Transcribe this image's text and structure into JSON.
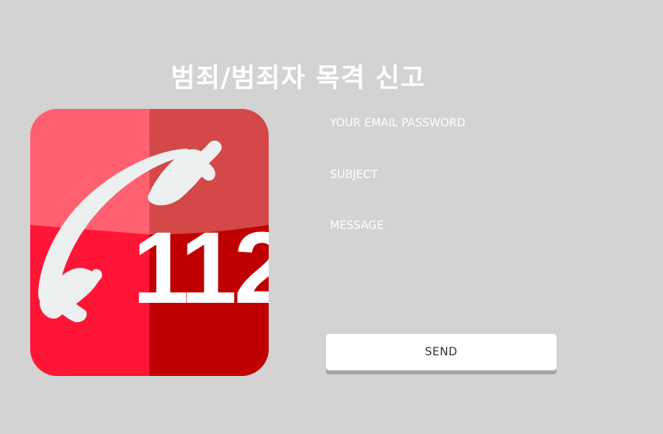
{
  "page": {
    "title": "범죄/범죄자 목격 신고"
  },
  "logo": {
    "number_text": "112",
    "icon": "phone-handset-icon",
    "colors": {
      "left_top": "#ff6070",
      "right_top": "#d44848",
      "left_bottom": "#ff1535",
      "right_bottom": "#c00000",
      "handset": "#ecf0f0"
    }
  },
  "form": {
    "email_placeholder": "YOUR EMAIL PASSWORD",
    "subject_placeholder": "SUBJECT",
    "message_placeholder": "MESSAGE",
    "send_label": "SEND"
  },
  "colors": {
    "background": "#d3d3d3",
    "text_on_background": "#ffffff",
    "button_background": "#ffffff",
    "button_shadow": "#a3a3a3"
  }
}
